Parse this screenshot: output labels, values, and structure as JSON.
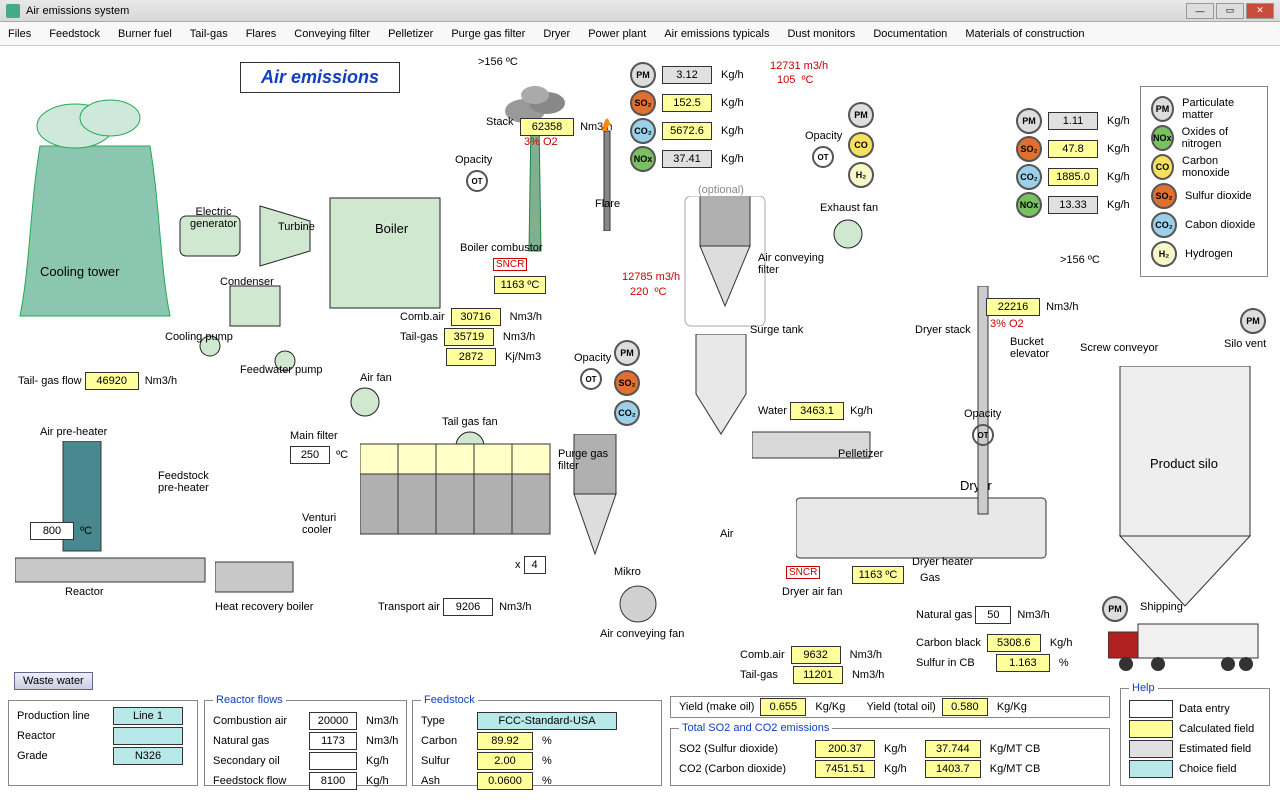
{
  "window": {
    "title": "Air emissions system"
  },
  "menu": [
    "Files",
    "Feedstock",
    "Burner fuel",
    "Tail-gas",
    "Flares",
    "Conveying filter",
    "Pelletizer",
    "Purge gas filter",
    "Dryer",
    "Power plant",
    "Air emissions typicals",
    "Dust monitors",
    "Documentation",
    "Materials of construction"
  ],
  "header": {
    "title": "Air emissions"
  },
  "stack": {
    "temp": ">156 ºC",
    "flow": "62358",
    "flow_unit": "Nm3/h",
    "o2": "3% O2",
    "pm": "3.12",
    "so2": "152.5",
    "co2": "5672.6",
    "nox": "37.41",
    "flow_label": "Stack",
    "unit": "Kg/h",
    "top_flow": "12731",
    "top_flow_unit": "m3/h",
    "top_temp": "105",
    "top_temp_unit": "ºC"
  },
  "opacity_label": "Opacity",
  "boiler": {
    "label": "Boiler",
    "combustor": "Boiler combustor",
    "sncr": "SNCR",
    "temp": "1163 ºC",
    "combair_lbl": "Comb.air",
    "combair": "30716",
    "combair_unit": "Nm3/h",
    "tailgas_lbl": "Tail-gas",
    "tailgas": "35719",
    "tailgas_unit": "Nm3/h",
    "heat": "2872",
    "heat_unit": "Kj/Nm3"
  },
  "power": {
    "gen": "Electric\ngenerator",
    "turbine": "Turbine",
    "condenser": "Condenser",
    "cooling_tower": "Cooling tower",
    "cooling_pump": "Cooling pump",
    "feedwater_pump": "Feedwater pump"
  },
  "tailgas": {
    "lbl": "Tail- gas flow",
    "val": "46920",
    "unit": "Nm3/h"
  },
  "airfan": "Air fan",
  "tailgasfan": "Tail gas fan",
  "mainfilter": {
    "lbl": "Main filter",
    "temp": "250",
    "temp_unit": "ºC",
    "transport_lbl": "Transport air",
    "transport": "9206",
    "transport_unit": "Nm3/h",
    "mult": "4"
  },
  "preheater": {
    "air": "Air pre-heater",
    "feed": "Feedstock\npre-heater",
    "hrb": "Heat recovery boiler",
    "venturi": "Venturi\ncooler"
  },
  "reactor": {
    "lbl": "Reactor",
    "temp": "800",
    "unit": "ºC"
  },
  "flare": {
    "lbl": "Flare",
    "flow": "12785",
    "flow_unit": "m3/h",
    "temp": "220",
    "temp_unit": "ºC"
  },
  "purge": "Purge gas\nfilter",
  "optional": "(optional)",
  "airconvfilter": "Air conveying\nfilter",
  "surge": "Surge tank",
  "exhaust": "Exhaust fan",
  "mikro": "Mikro",
  "airconvfan": "Air conveying fan",
  "air_lbl": "Air",
  "pelletizer": {
    "lbl": "Pelletizer",
    "water_lbl": "Water",
    "water": "3463.1",
    "water_unit": "Kg/h"
  },
  "dryer": {
    "lbl": "Dryer",
    "sncr": "SNCR",
    "temp": "1163 ºC",
    "heater": "Dryer heater",
    "gas": "Gas",
    "airfan": "Dryer air fan",
    "natgas_lbl": "Natural gas",
    "natgas": "50",
    "natgas_unit": "Nm3/h",
    "combair_lbl": "Comb.air",
    "combair": "9632",
    "combair_unit": "Nm3/h",
    "tailgas_lbl": "Tail-gas",
    "tailgas": "11201",
    "tailgas_unit": "Nm3/h",
    "stack": "Dryer stack",
    "flow": "22216",
    "flow_unit": "Nm3/h",
    "o2": "3% O2",
    "top_temp": ">156 ºC",
    "pm": "1.11",
    "so2": "47.8",
    "co2": "1885.0",
    "nox": "13.33",
    "unit": "Kg/h"
  },
  "bucket": "Bucket\nelevator",
  "screw": "Screw conveyor",
  "silovent": "Silo vent",
  "silo": "Product silo",
  "shipping": "Shipping",
  "cb": {
    "lbl": "Carbon black",
    "val": "5308.6",
    "unit": "Kg/h",
    "sulfur_lbl": "Sulfur in CB",
    "sulfur": "1.163",
    "sulfur_unit": "%"
  },
  "wastewater": "Waste water",
  "prodline": {
    "pl_lbl": "Production line",
    "pl": "Line 1",
    "reactor_lbl": "Reactor",
    "reactor": "",
    "grade_lbl": "Grade",
    "grade": "N326"
  },
  "reactorflows": {
    "legend": "Reactor flows",
    "combair_lbl": "Combustion  air",
    "combair": "20000",
    "combair_unit": "Nm3/h",
    "natgas_lbl": "Natural gas",
    "natgas": "1173",
    "natgas_unit": "Nm3/h",
    "secoil_lbl": "Secondary oil",
    "secoil": "",
    "secoil_unit": "Kg/h",
    "feedflow_lbl": "Feedstock flow",
    "feedflow": "8100",
    "feedflow_unit": "Kg/h"
  },
  "feedstock": {
    "legend": "Feedstock",
    "type_lbl": "Type",
    "type": "FCC-Standard-USA",
    "carbon_lbl": "Carbon",
    "carbon": "89.92",
    "pct": "%",
    "sulfur_lbl": "Sulfur",
    "sulfur": "2.00",
    "ash_lbl": "Ash",
    "ash": "0.0600"
  },
  "yields": {
    "makeoil_lbl": "Yield (make oil)",
    "makeoil": "0.655",
    "unit": "Kg/Kg",
    "totoil_lbl": "Yield (total oil)",
    "totoil": "0.580"
  },
  "totals": {
    "legend": "Total SO2 and CO2 emissions",
    "so2_lbl": "SO2 (Sulfur dioxide)",
    "so2": "200.37",
    "so2_mt": "37.744",
    "co2_lbl": "CO2 (Carbon dioxide)",
    "co2": "7451.51",
    "co2_mt": "1403.7",
    "u1": "Kg/h",
    "u2": "Kg/MT CB"
  },
  "legend_badges": {
    "pm": "Particulate matter",
    "nox": "Oxides of nitrogen",
    "co": "Carbon monoxide",
    "so2": "Sulfur dioxide",
    "co2": "Cabon dioxide",
    "h2": "Hydrogen"
  },
  "help": {
    "legend": "Help",
    "de": "Data entry",
    "calc": "Calculated field",
    "est": "Estimated field",
    "choice": "Choice field"
  }
}
